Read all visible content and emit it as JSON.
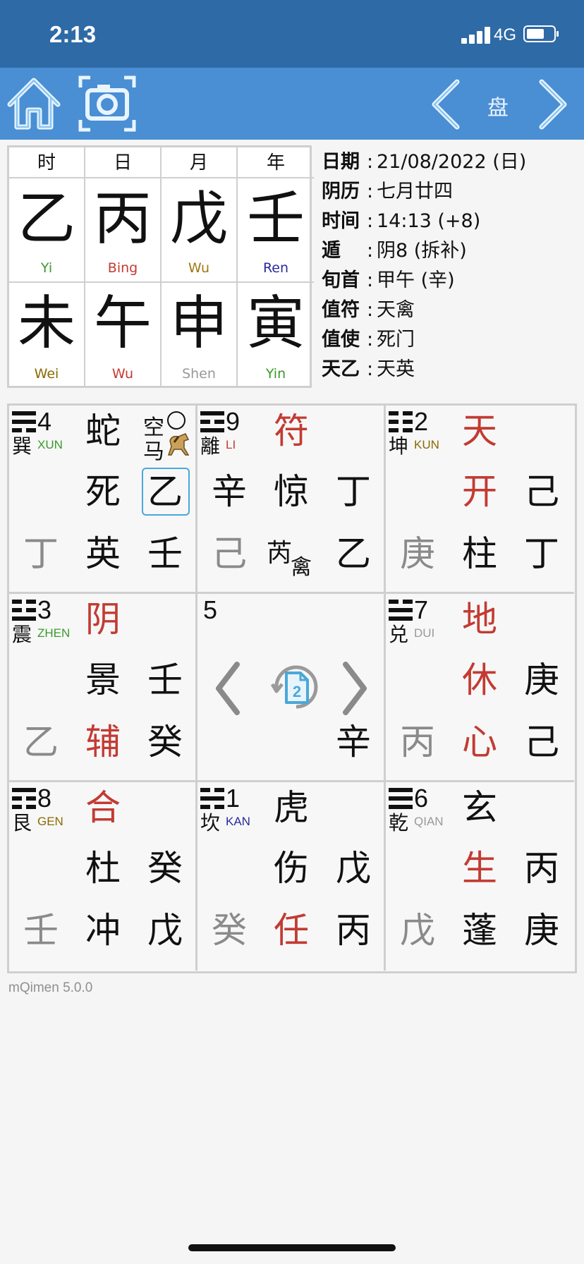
{
  "status_bar": {
    "time": "2:13",
    "network": "4G"
  },
  "toolbar": {
    "title": "盘"
  },
  "pillars": [
    {
      "header": "时",
      "stem": "乙",
      "stem_py": "Yi",
      "stem_py_color": "#3a9a2a",
      "branch": "未",
      "branch_py": "Wei",
      "branch_py_color": "#8a6a00"
    },
    {
      "header": "日",
      "stem": "丙",
      "stem_py": "Bing",
      "stem_py_color": "#c23b32",
      "branch": "午",
      "branch_py": "Wu",
      "branch_py_color": "#c23b32"
    },
    {
      "header": "月",
      "stem": "戊",
      "stem_py": "Wu",
      "stem_py_color": "#a07810",
      "branch": "申",
      "branch_py": "Shen",
      "branch_py_color": "#999999"
    },
    {
      "header": "年",
      "stem": "壬",
      "stem_py": "Ren",
      "stem_py_color": "#2a2aa0",
      "branch": "寅",
      "branch_py": "Yin",
      "branch_py_color": "#3a9a2a"
    }
  ],
  "info": [
    {
      "label": "日期",
      "value": "21/08/2022 (日)"
    },
    {
      "label": "阴历",
      "value": "七月廿四"
    },
    {
      "label": "时间",
      "value": "14:13 (+8)"
    },
    {
      "label": "遁",
      "value": "阴8 (拆补)"
    },
    {
      "label": "旬首",
      "value": "甲午 (辛)"
    },
    {
      "label": "值符",
      "value": "天禽"
    },
    {
      "label": "值使",
      "value": "死门"
    },
    {
      "label": "天乙",
      "value": "天英"
    }
  ],
  "palaces": {
    "xun": {
      "num": "4",
      "trigram": "巽",
      "py": "XUN",
      "py_color": "#3a9a2a",
      "deity": "蛇",
      "kong": "空",
      "ma": "马",
      "door": "死",
      "door_stem": "乙",
      "earth": "丁",
      "star": "英",
      "star_stem": "壬"
    },
    "li": {
      "num": "9",
      "trigram": "離",
      "py": "LI",
      "py_color": "#c23b32",
      "deity": "符",
      "left": "辛",
      "door": "惊",
      "door_stem": "丁",
      "earth": "己",
      "star": "芮",
      "star_sub": "禽",
      "star_stem": "乙"
    },
    "kun": {
      "num": "2",
      "trigram": "坤",
      "py": "KUN",
      "py_color": "#8a6a00",
      "deity": "天",
      "door": "开",
      "door_stem": "己",
      "earth": "庚",
      "star": "柱",
      "star_stem": "丁"
    },
    "zhen": {
      "num": "3",
      "trigram": "震",
      "py": "ZHEN",
      "py_color": "#3a9a2a",
      "deity": "阴",
      "door": "景",
      "door_stem": "壬",
      "earth": "乙",
      "star": "辅",
      "star_stem": "癸"
    },
    "center": {
      "num": "5",
      "page_badge": "2",
      "stem": "辛"
    },
    "dui": {
      "num": "7",
      "trigram": "兑",
      "py": "DUI",
      "py_color": "#999999",
      "deity": "地",
      "door": "休",
      "door_stem": "庚",
      "earth": "丙",
      "star": "心",
      "star_stem": "己"
    },
    "gen": {
      "num": "8",
      "trigram": "艮",
      "py": "GEN",
      "py_color": "#8a6a00",
      "deity": "合",
      "door": "杜",
      "door_stem": "癸",
      "earth": "壬",
      "star": "冲",
      "star_stem": "戊"
    },
    "kan": {
      "num": "1",
      "trigram": "坎",
      "py": "KAN",
      "py_color": "#2a2aa0",
      "deity": "虎",
      "door": "伤",
      "door_stem": "戊",
      "earth": "癸",
      "star": "任",
      "star_stem": "丙"
    },
    "qian": {
      "num": "6",
      "trigram": "乾",
      "py": "QIAN",
      "py_color": "#999999",
      "deity": "玄",
      "door": "生",
      "door_stem": "丙",
      "earth": "戊",
      "star": "蓬",
      "star_stem": "庚"
    }
  },
  "footer": {
    "version": "mQimen 5.0.0"
  },
  "colors": {
    "status_bar": "#2e6aa6",
    "toolbar": "#4a8ed4",
    "red": "#c23b32",
    "gray": "#8a8a8a"
  },
  "icons": [
    "home-icon",
    "camera-icon",
    "chevron-left-icon",
    "chevron-right-icon",
    "horse-icon",
    "refresh-page-icon"
  ]
}
